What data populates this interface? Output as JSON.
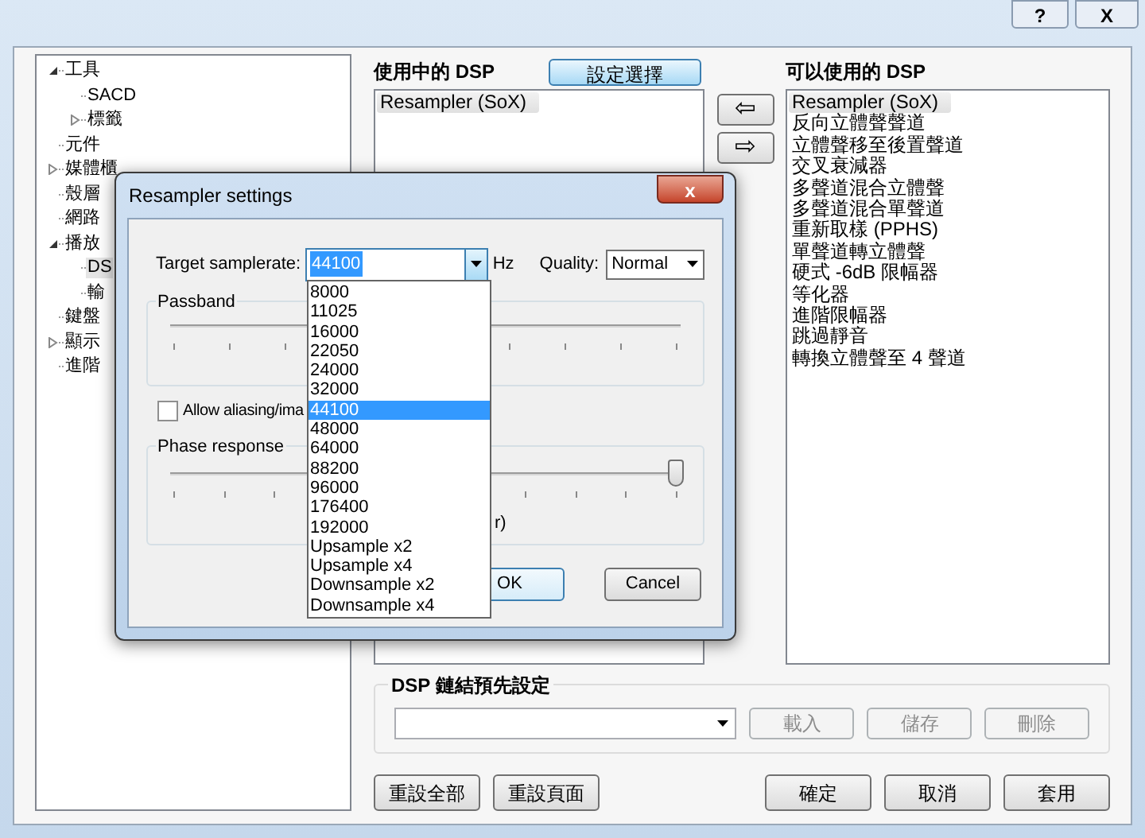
{
  "window": {
    "help_button": "?",
    "close_button": "X"
  },
  "tree": [
    {
      "label": "工具",
      "expanded": true,
      "children": [
        {
          "label": "SACD"
        },
        {
          "label": "標籤",
          "expanded": false
        }
      ]
    },
    {
      "label": "元件"
    },
    {
      "label": "媒體櫃",
      "expanded": false
    },
    {
      "label": "殼層"
    },
    {
      "label": "網路"
    },
    {
      "label": "播放",
      "expanded": true,
      "children": [
        {
          "label": "DS",
          "selected": true
        },
        {
          "label": "輸",
          "selected": false
        }
      ]
    },
    {
      "label": "鍵盤"
    },
    {
      "label": "顯示",
      "expanded": false
    },
    {
      "label": "進階"
    }
  ],
  "active_dsp": {
    "title": "使用中的 DSP",
    "configure_button": "設定選擇",
    "items": [
      {
        "label": "Resampler (SoX)",
        "selected": true
      }
    ]
  },
  "move_buttons": [
    "⇦",
    "⇨"
  ],
  "available_dsp": {
    "title": "可以使用的 DSP",
    "items": [
      {
        "label": "Resampler (SoX)",
        "selected": true
      },
      {
        "label": "反向立體聲聲道",
        "selected": false
      },
      {
        "label": "立體聲移至後置聲道",
        "selected": false
      },
      {
        "label": "交叉衰減器",
        "selected": false
      },
      {
        "label": "多聲道混合立體聲",
        "selected": false
      },
      {
        "label": "多聲道混合單聲道",
        "selected": false
      },
      {
        "label": "重新取樣 (PPHS)",
        "selected": false
      },
      {
        "label": "單聲道轉立體聲",
        "selected": false
      },
      {
        "label": "硬式 -6dB 限幅器",
        "selected": false
      },
      {
        "label": "等化器",
        "selected": false
      },
      {
        "label": "進階限幅器",
        "selected": false
      },
      {
        "label": "跳過靜音",
        "selected": false
      },
      {
        "label": "轉換立體聲至 4 聲道",
        "selected": false
      }
    ]
  },
  "preset_group": {
    "title": "DSP 鏈結預先設定",
    "buttons": [
      {
        "label": "載入",
        "disabled": true
      },
      {
        "label": "儲存",
        "disabled": true
      },
      {
        "label": "刪除",
        "disabled": true
      }
    ]
  },
  "footer_left": [
    "重設全部",
    "重設頁面"
  ],
  "footer_right": [
    "確定",
    "取消",
    "套用"
  ],
  "dialog": {
    "title": "Resampler settings",
    "close_button": "x",
    "samplerate_label": "Target samplerate:",
    "samplerate_value": "44100",
    "unit": "Hz",
    "quality_label": "Quality:",
    "quality_value": "Normal",
    "passband_title": "Passband",
    "aliasing_label": "Allow aliasing/ima",
    "aliasing_checked": false,
    "phase_response": {
      "title": "Phase response",
      "level": 1,
      "hidden_label": "r)"
    },
    "ok": "OK",
    "cancel": "Cancel",
    "dropdown": [
      {
        "label": "8000",
        "selected": false
      },
      {
        "label": "11025",
        "selected": false
      },
      {
        "label": "16000",
        "selected": false
      },
      {
        "label": "22050",
        "selected": false
      },
      {
        "label": "24000",
        "selected": false
      },
      {
        "label": "32000",
        "selected": false
      },
      {
        "label": "44100",
        "selected": true
      },
      {
        "label": "48000",
        "selected": false
      },
      {
        "label": "64000",
        "selected": false
      },
      {
        "label": "88200",
        "selected": false
      },
      {
        "label": "96000",
        "selected": false
      },
      {
        "label": "176400",
        "selected": false
      },
      {
        "label": "192000",
        "selected": false
      },
      {
        "label": "Upsample x2",
        "selected": false
      },
      {
        "label": "Upsample x4",
        "selected": false
      },
      {
        "label": "Downsample x2",
        "selected": false
      },
      {
        "label": "Downsample x4",
        "selected": false
      }
    ]
  }
}
